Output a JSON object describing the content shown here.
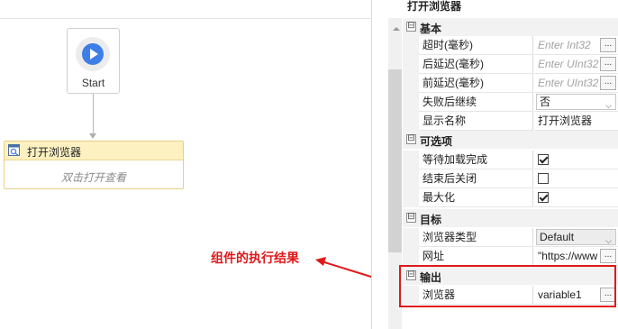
{
  "canvas": {
    "start_label": "Start",
    "activity_title": "打开浏览器",
    "activity_hint": "双击打开查看"
  },
  "annotation": {
    "text": "组件的执行结果",
    "color": "#e0191b"
  },
  "panel": {
    "title": "打开浏览器",
    "sections": {
      "basic": "基本",
      "optional": "可选项",
      "target": "目标",
      "output": "输出"
    },
    "rows": {
      "timeout": {
        "label": "超时(毫秒)",
        "placeholder": "Enter Int32"
      },
      "delay_after": {
        "label": "后延迟(毫秒)",
        "placeholder": "Enter UInt32"
      },
      "delay_before": {
        "label": "前延迟(毫秒)",
        "placeholder": "Enter UInt32"
      },
      "continue_on_error": {
        "label": "失败后继续",
        "value": "否"
      },
      "display_name": {
        "label": "显示名称",
        "value": "打开浏览器"
      },
      "wait_load": {
        "label": "等待加载完成",
        "checked": true
      },
      "close_after": {
        "label": "结束后关闭",
        "checked": false
      },
      "maximize": {
        "label": "最大化",
        "checked": true
      },
      "browser_type": {
        "label": "浏览器类型",
        "value": "Default"
      },
      "url": {
        "label": "网址",
        "value": "\"https://www"
      },
      "browser": {
        "label": "浏览器",
        "value": "variable1"
      }
    },
    "ellipsis": "...",
    "toggle_symbol": "⊟"
  },
  "icons": {
    "start": "play-icon",
    "activity": "browser-icon"
  },
  "colors": {
    "play": "#3d7ee8",
    "activity_header": "#fdf1c2",
    "highlight": "#e0191b"
  }
}
